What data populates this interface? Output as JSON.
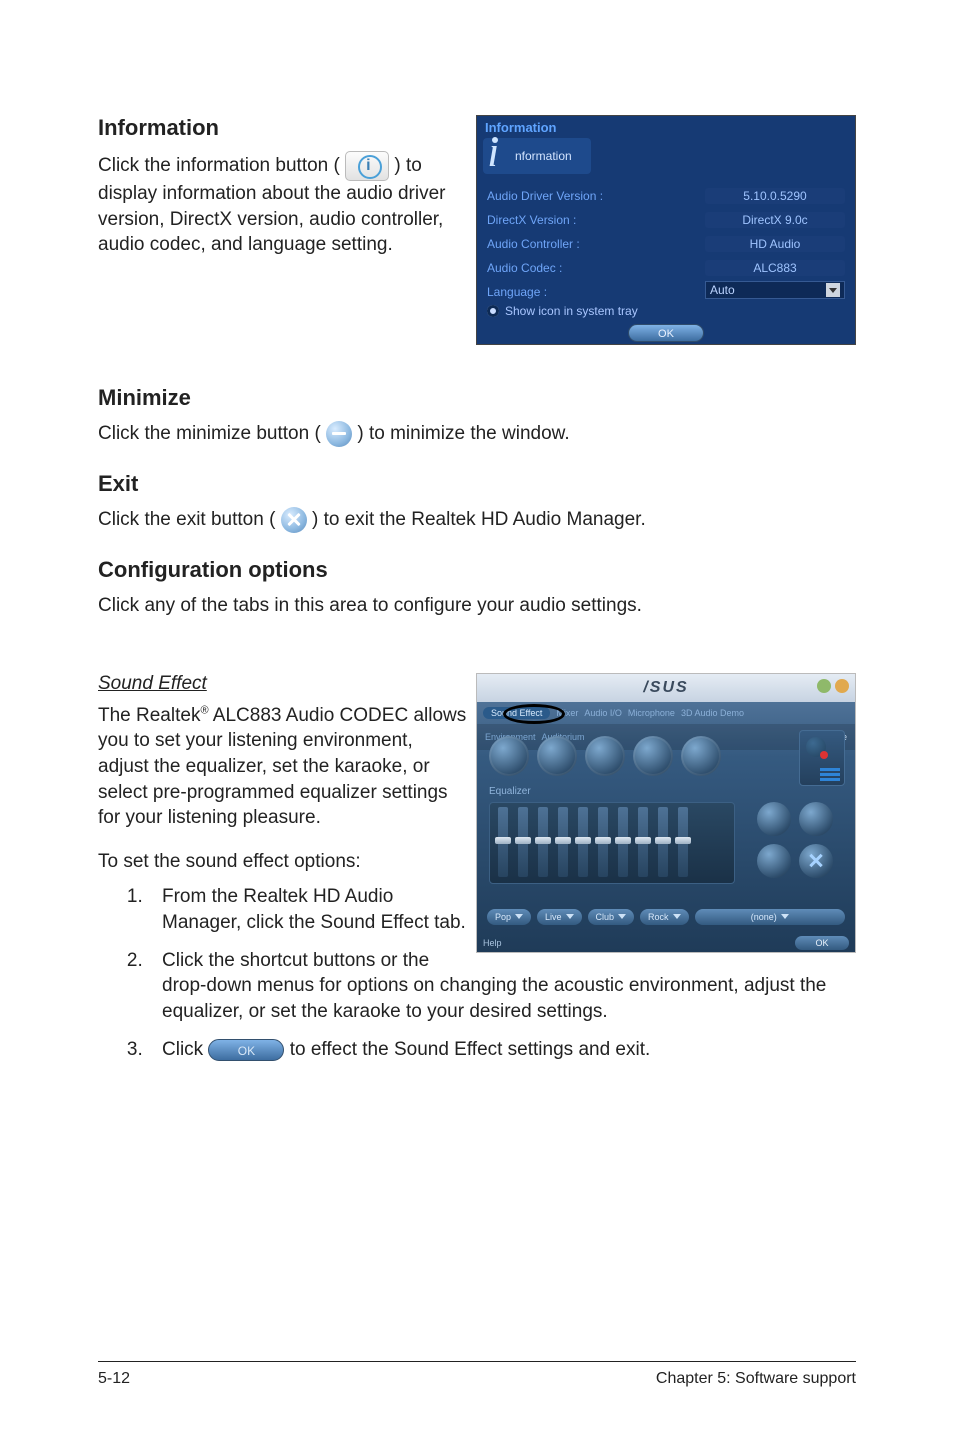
{
  "info_section": {
    "heading": "Information",
    "text_before_icon": "Click the information button (",
    "text_after_icon": ") to display information about the audio driver version, DirectX version, audio controller, audio codec, and language setting."
  },
  "info_panel": {
    "title": "Information",
    "chip_label": "nformation",
    "rows": [
      {
        "label": "Audio Driver Version :",
        "value": "5.10.0.5290"
      },
      {
        "label": "DirectX Version :",
        "value": "DirectX 9.0c"
      },
      {
        "label": "Audio Controller :",
        "value": "HD Audio"
      },
      {
        "label": "Audio Codec :",
        "value": "ALC883"
      }
    ],
    "language_label": "Language :",
    "language_value": "Auto",
    "tray_label": "Show icon in system tray",
    "ok": "OK"
  },
  "minimize_section": {
    "heading": "Minimize",
    "text_before": "Click the minimize button (",
    "text_after": ") to minimize the window."
  },
  "exit_section": {
    "heading": "Exit",
    "text_before": "Click the exit button (",
    "text_after": ") to exit the Realtek HD Audio Manager."
  },
  "config_section": {
    "heading": "Configuration options",
    "text": "Click any of the tabs in this area to configure your audio settings."
  },
  "sound_effect": {
    "sub_heading": "Sound Effect",
    "para_before_reg": "The Realtek",
    "reg": "®",
    "para_after_reg": " ALC883 Audio CODEC allows you to set your listening environment, adjust the equalizer, set the karaoke, or select pre-programmed equalizer settings for your listening pleasure.",
    "para2": "To set the sound effect options:",
    "steps": [
      "From the Realtek HD Audio Manager, click the Sound Effect tab.",
      "Click the shortcut buttons or the drop-down menus for options on changing the acoustic environment, adjust the equalizer, or set the karaoke to your desired settings.",
      {
        "before": "Click ",
        "button": "OK",
        "after": " to effect the Sound Effect settings and exit."
      }
    ]
  },
  "se_panel": {
    "logo": "/SUS",
    "tabs": [
      "Sound Effect",
      "Mixer",
      "Audio I/O",
      "Microphone",
      "3D Audio Demo"
    ],
    "env_label": "Environment",
    "env_sub": "Auditorium",
    "karaoke_label": "Karaoke",
    "eq_label": "Equalizer",
    "bottom_buttons": [
      "Pop",
      "Live",
      "Club",
      "Rock",
      "(none)"
    ],
    "help": "Help",
    "ok": "OK"
  },
  "footer": {
    "left": "5-12",
    "right": "Chapter 5: Software support"
  }
}
